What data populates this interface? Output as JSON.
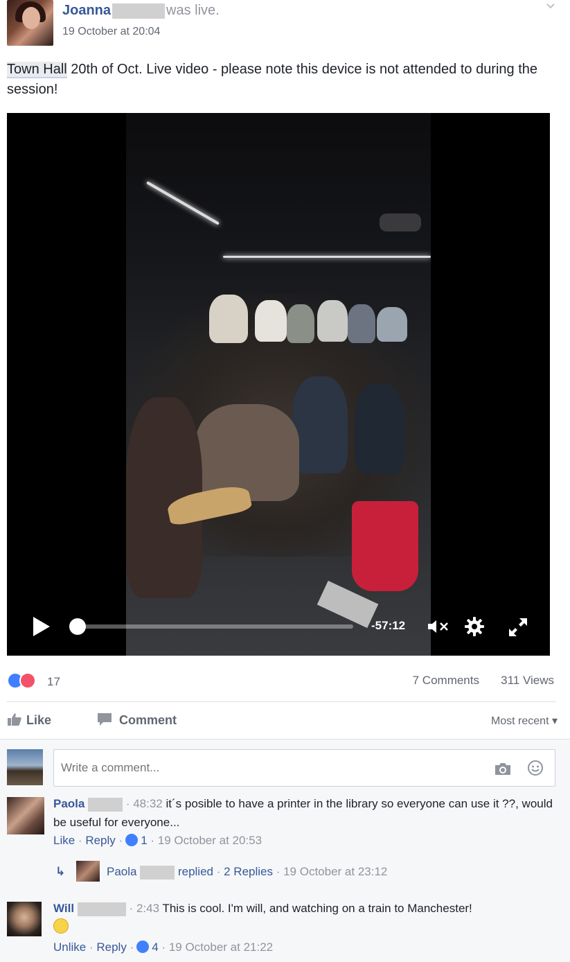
{
  "post": {
    "author": "Joanna",
    "action": "was live.",
    "timestamp": "19 October at 20:04",
    "text_tag": "Town Hall",
    "text_rest": " 20th of Oct. Live video - please note this device is not attended to during the session!"
  },
  "video": {
    "time_remaining": "-57:12",
    "progress": 0.0
  },
  "stats": {
    "reaction_count": "17",
    "comments": "7 Comments",
    "views": "311 Views"
  },
  "actions": {
    "like": "Like",
    "comment": "Comment",
    "sort": "Most recent ▾"
  },
  "composer": {
    "placeholder": "Write a comment..."
  },
  "comments": [
    {
      "name": "Paola",
      "timecode": "48:32",
      "text": " it´s posible to have a printer in the library so everyone can use it ??, would be useful for everyone...",
      "action1": "Like",
      "action2": "Reply",
      "likes": "1",
      "timestamp": "19 October at 20:53",
      "reply_name": "Paola",
      "reply_verb": "replied",
      "reply_link": "2 Replies",
      "reply_time": "19 October at 23:12"
    },
    {
      "name": "Will",
      "timecode": "2:43",
      "text": " This is cool. I'm will, and watching on a train to Manchester!",
      "action1": "Unlike",
      "action2": "Reply",
      "likes": "4",
      "timestamp": "19 October at 21:22"
    }
  ],
  "colors": {
    "link": "#365899",
    "muted": "#90949c",
    "like_blue": "#4080ff",
    "love_red": "#f25268"
  }
}
